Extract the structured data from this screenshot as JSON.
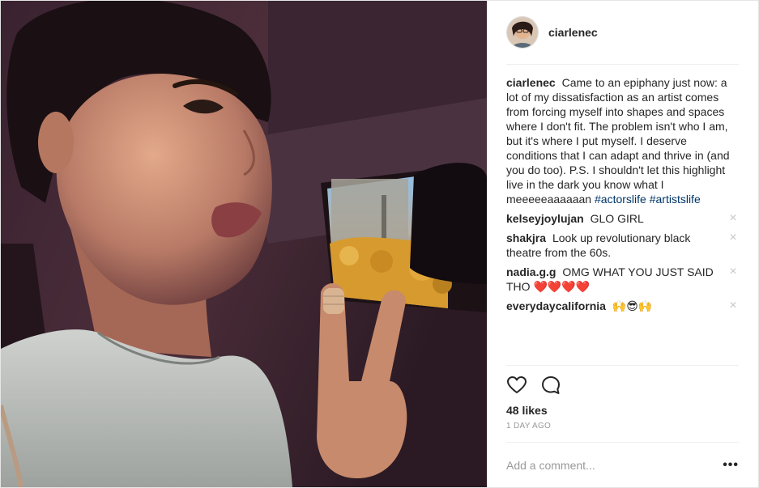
{
  "post": {
    "username": "ciarlenec",
    "caption_text": "Came to an epiphany just now: a lot of my dissatisfaction as an artist comes from forcing myself into shapes and spaces where I don't fit. The problem isn't who I am, but it's where I put myself. I deserve conditions that I can adapt and thrive in (and you do too). P.S. I shouldn't let this highlight live in the dark you know what I meeeeeaaaaaan",
    "hashtags": [
      "#actorslife",
      "#artistslife"
    ],
    "likes": "48 likes",
    "time": "1 DAY AGO"
  },
  "comments": [
    {
      "user": "kelseyjoylujan",
      "text": "GLO GIRL"
    },
    {
      "user": "shakjra",
      "text": "Look up revolutionary black theatre from the 60s."
    },
    {
      "user": "nadia.g.g",
      "text": "OMG WHAT YOU JUST SAID THO ❤️❤️❤️❤️"
    },
    {
      "user": "everydaycalifornia",
      "text": "🙌😎🙌"
    }
  ],
  "remove_glyph": "×",
  "add_comment": {
    "placeholder": "Add a comment..."
  },
  "more_glyph": "•••",
  "icons": {
    "like": "heart-outline-icon",
    "comment": "speech-bubble-icon",
    "options": "ellipsis-icon",
    "remove": "close-icon"
  },
  "colors": {
    "text": "#262626",
    "hashtag": "#003569",
    "muted": "#999999",
    "divider": "#efefef"
  }
}
